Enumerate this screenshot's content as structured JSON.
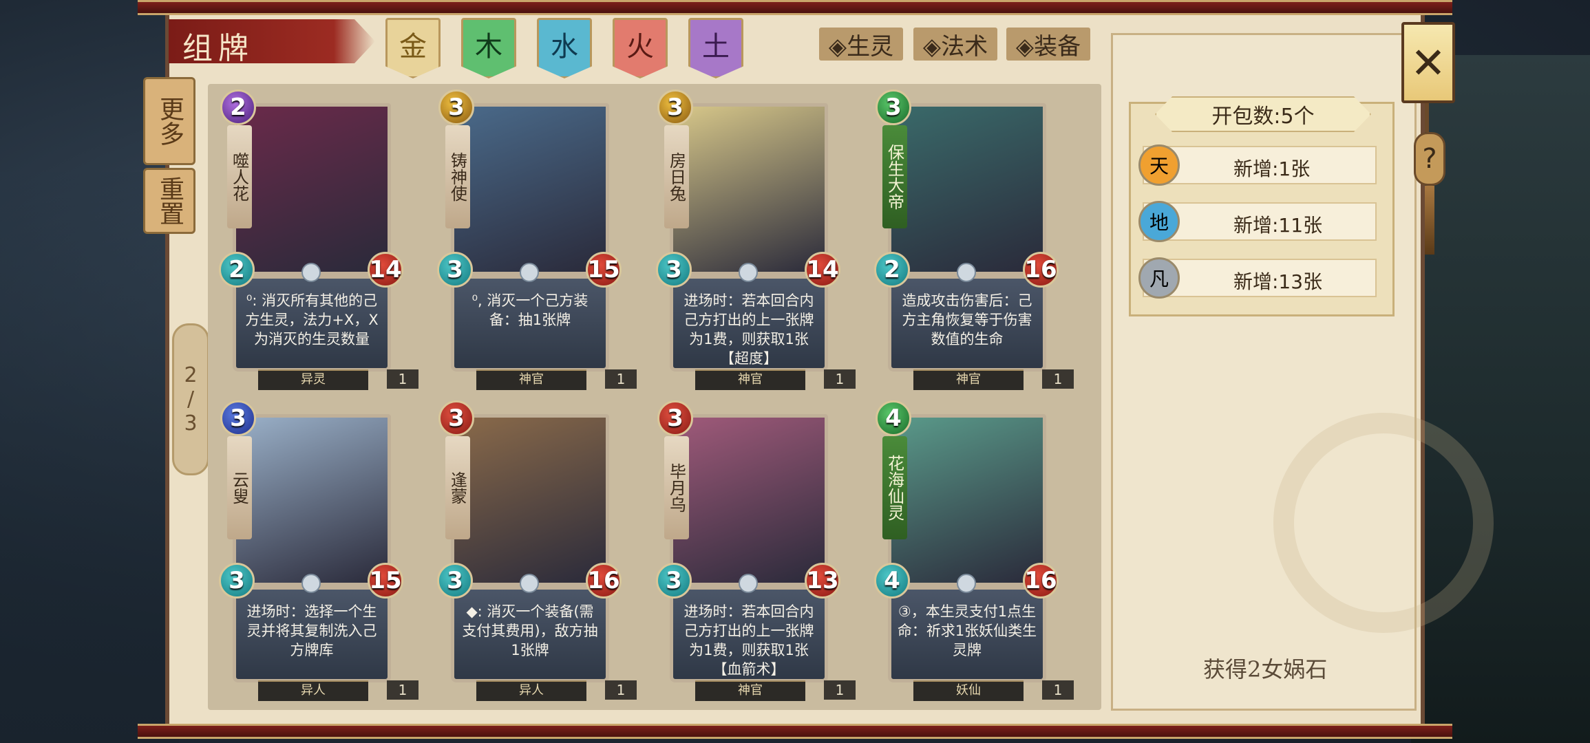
{
  "title": "组牌",
  "element_tabs": [
    {
      "label": "金",
      "color": "#e8d39a",
      "text": "#7a5a18"
    },
    {
      "label": "木",
      "color": "#5fbf70",
      "text": "#0f3a1a"
    },
    {
      "label": "水",
      "color": "#5ab8d0",
      "text": "#0f3a50"
    },
    {
      "label": "火",
      "color": "#e27b6e",
      "text": "#5a1a14"
    },
    {
      "label": "土",
      "color": "#a778c8",
      "text": "#3a1a50"
    }
  ],
  "filters": [
    "◈生灵",
    "◈法术",
    "◈装备"
  ],
  "side_buttons": {
    "more": "更多",
    "reset": "重置"
  },
  "page": {
    "current": "2",
    "total": "3"
  },
  "cards": [
    {
      "name": "噬人花",
      "cost": "2",
      "atk": "2",
      "hp": "14",
      "text": "⁰: 消灭所有其他的己方生灵，法力+X，X为消灭的生灵数量",
      "race": "异灵",
      "count": "1",
      "cost_color": "purple-cost"
    },
    {
      "name": "铸神使",
      "cost": "3",
      "atk": "3",
      "hp": "15",
      "text": "⁰, 消灭一个己方装备：抽1张牌",
      "race": "神官",
      "count": "1",
      "cost_color": "gold-cost"
    },
    {
      "name": "房日兔",
      "cost": "3",
      "atk": "3",
      "hp": "14",
      "text": "进场时：若本回合内己方打出的上一张牌为1费，则获取1张【超度】",
      "race": "神官",
      "count": "1",
      "cost_color": "gold-cost"
    },
    {
      "name": "保生大帝",
      "cost": "3",
      "atk": "2",
      "hp": "16",
      "text": "造成攻击伤害后：己方主角恢复等于伤害数值的生命",
      "race": "神官",
      "count": "1",
      "cost_color": "green-cost",
      "green_name": true
    },
    {
      "name": "云叟",
      "cost": "3",
      "atk": "3",
      "hp": "15",
      "text": "进场时：选择一个生灵并将其复制洗入己方牌库",
      "race": "异人",
      "count": "1",
      "cost_color": "blue-cost"
    },
    {
      "name": "逢蒙",
      "cost": "3",
      "atk": "3",
      "hp": "16",
      "text": "◆: 消灭一个装备(需支付其费用)，敌方抽1张牌",
      "race": "异人",
      "count": "1",
      "cost_color": "red-cost"
    },
    {
      "name": "毕月乌",
      "cost": "3",
      "atk": "3",
      "hp": "13",
      "text": "进场时：若本回合内己方打出的上一张牌为1费，则获取1张【血箭术】",
      "race": "神官",
      "count": "1",
      "cost_color": "red-cost"
    },
    {
      "name": "花海仙灵",
      "cost": "4",
      "atk": "4",
      "hp": "16",
      "text": "③，本生灵支付1点生命：祈求1张妖仙类生灵牌",
      "race": "妖仙",
      "count": "1",
      "cost_color": "green-cost",
      "green_name": true
    }
  ],
  "pack": {
    "title": "开包数:5个",
    "rows": [
      {
        "badge": "天",
        "text": "新增:1张",
        "badge_color": "#f0a030"
      },
      {
        "badge": "地",
        "text": "新增:11张",
        "badge_color": "#4aa8d8"
      },
      {
        "badge": "凡",
        "text": "新增:13张",
        "badge_color": "#a0a8b0"
      }
    ]
  },
  "reward": "获得2女娲石",
  "close_icon": "✕",
  "help_icon": "?"
}
